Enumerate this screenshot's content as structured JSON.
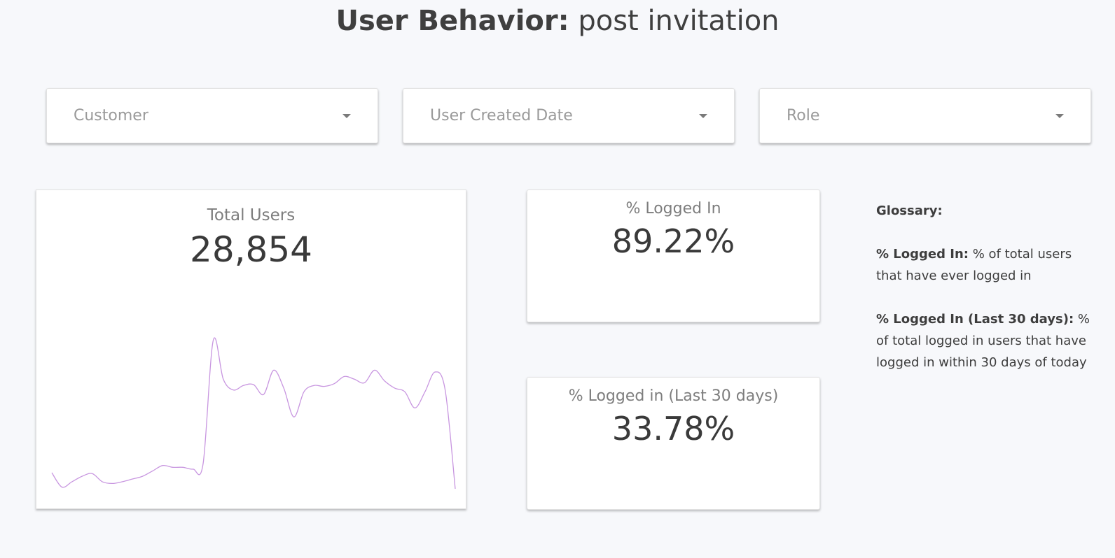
{
  "header": {
    "title_strong": "User Behavior:",
    "title_light": "post invitation"
  },
  "filters": {
    "customer": "Customer",
    "user_created_date": "User Created Date",
    "role": "Role"
  },
  "cards": {
    "total_users": {
      "title": "Total Users",
      "value": "28,854"
    },
    "logged_in": {
      "title": "% Logged In",
      "value": "89.22%"
    },
    "logged_in_30": {
      "title": "% Logged in (Last 30 days)",
      "value": "33.78%"
    }
  },
  "glossary": {
    "heading": "Glossary:",
    "entries": [
      {
        "term": "% Logged In:",
        "definition": " % of total users that have ever logged in"
      },
      {
        "term": "% Logged In (Last 30 days):",
        "definition": " % of total logged in users that have logged in within 30 days of today"
      }
    ]
  },
  "colors": {
    "sparkline": "#c896e0",
    "background": "#f7f8fb"
  },
  "chart_data": {
    "type": "line",
    "values": [
      28,
      12,
      18,
      24,
      27,
      18,
      16,
      18,
      21,
      24,
      30,
      36,
      34,
      34,
      32,
      38,
      175,
      132,
      120,
      125,
      126,
      115,
      142,
      122,
      90,
      118,
      125,
      124,
      127,
      135,
      132,
      128,
      142,
      130,
      122,
      118,
      100,
      118,
      140,
      120,
      10
    ]
  }
}
